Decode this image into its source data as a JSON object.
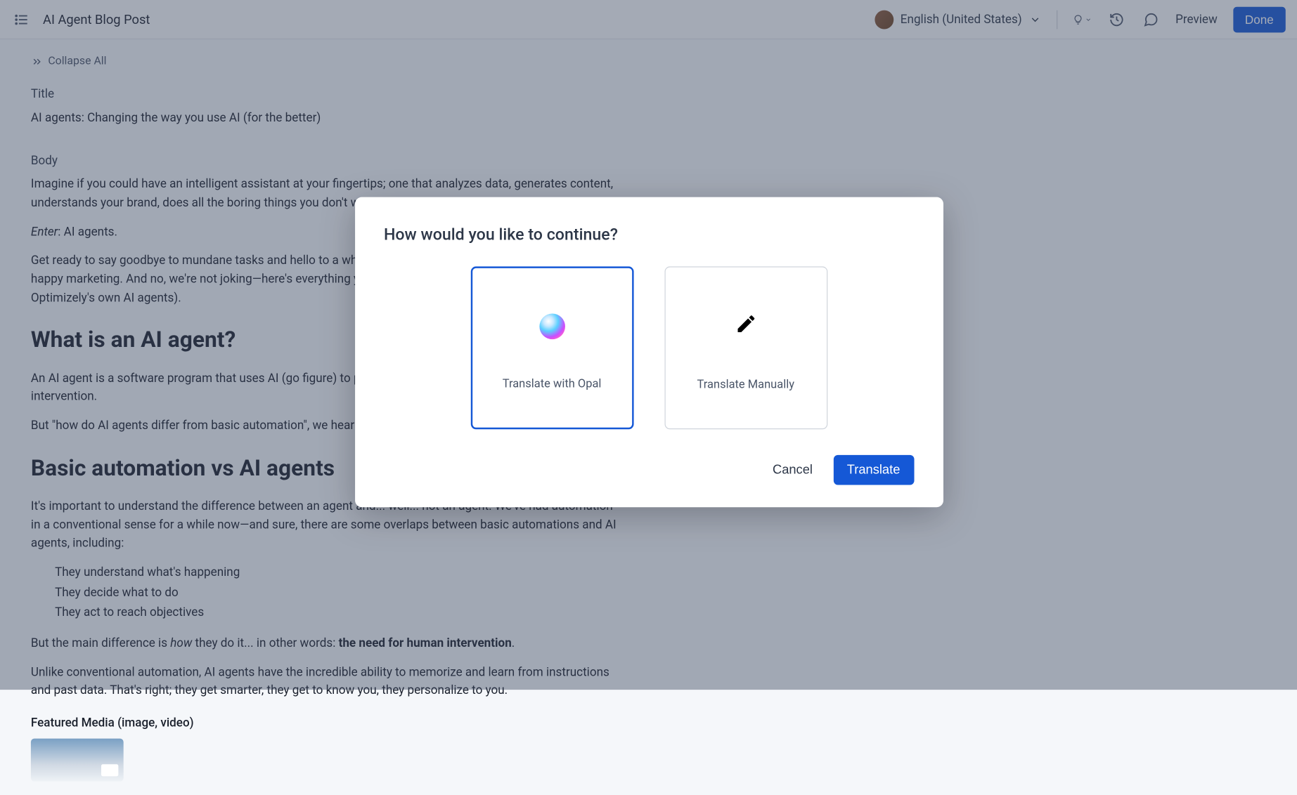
{
  "topbar": {
    "doc_title": "AI Agent Blog Post",
    "language": "English (United States)",
    "preview_label": "Preview",
    "done_label": "Done"
  },
  "collapse_label": "Collapse All",
  "title_field_label": "Title",
  "title_value": "AI agents: Changing the way you use AI (for the better)",
  "body_field_label": "Body",
  "body": {
    "p1": "Imagine if you could have an intelligent assistant at your fingertips; one that analyzes data, generates content, understands your brand, does all the boring things you don't want to...",
    "p2a": "Enter",
    "p2b": ": AI agents.",
    "p3": "Get ready to say goodbye to mundane tasks and hello to a whole new world of crazy efficiency and happy happy marketing. And no, we're not joking—here's everything you need to know about AI agents (including Optimizely's own AI agents).",
    "h2a": "What is an AI agent?",
    "p4": "An AI agent is a software program that uses AI (go figure) to perform tasks and achieve goals without human intervention.",
    "p5": "But \"how do AI agents differ from basic automation\", we hear you ask...",
    "h2b": "Basic automation vs AI agents",
    "p6": "It's important to understand the difference between an agent and... well... not an agent. We've had automation in a conventional sense for a while now—and sure, there are some overlaps between basic automations and AI agents, including:",
    "bullets": [
      "They understand what's happening",
      "They decide what to do",
      "They act to reach objectives"
    ],
    "p7a": "But the main difference is ",
    "p7b": "how",
    "p7c": " they do it... in other words: ",
    "p7d": "the need for human intervention",
    "p7e": ".",
    "p8": "Unlike conventional automation, AI agents have the incredible ability to memorize and learn from instructions and past data. That's right; they get smarter, they get to know you, they personalize to you."
  },
  "featured_label": "Featured Media (image, video)",
  "modal": {
    "title": "How would you like to continue?",
    "option1_label": "Translate with Opal",
    "option2_label": "Translate Manually",
    "cancel_label": "Cancel",
    "translate_label": "Translate"
  }
}
